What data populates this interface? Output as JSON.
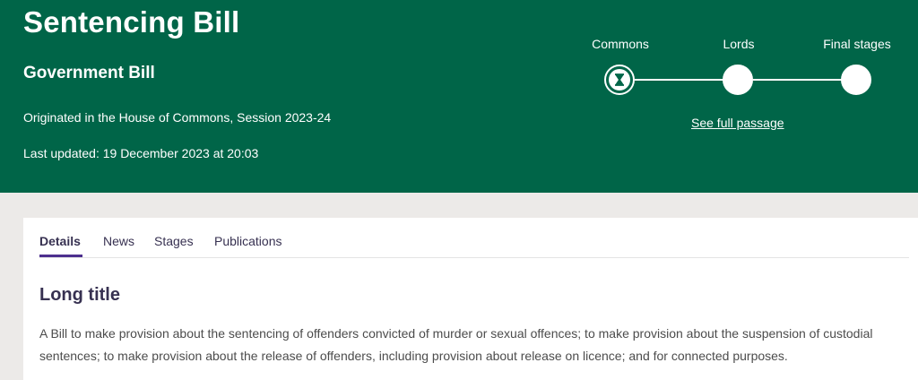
{
  "header": {
    "title": "Sentencing Bill",
    "bill_type": "Government Bill",
    "originated": "Originated in the House of Commons, Session 2023-24",
    "last_updated": "Last updated: 19 December 2023 at 20:03"
  },
  "progress": {
    "stages": [
      {
        "label": "Commons",
        "state": "current",
        "icon": "hourglass-icon"
      },
      {
        "label": "Lords",
        "state": "future"
      },
      {
        "label": "Final stages",
        "state": "future"
      }
    ],
    "see_full_passage": "See full passage"
  },
  "tabs": [
    {
      "label": "Details",
      "active": true
    },
    {
      "label": "News",
      "active": false
    },
    {
      "label": "Stages",
      "active": false
    },
    {
      "label": "Publications",
      "active": false
    }
  ],
  "details": {
    "heading": "Long title",
    "text": "A Bill to make provision about the sentencing of offenders convicted of murder or sexual offences; to make provision about the suspension of custodial sentences; to make provision about the release of offenders, including provision about release on licence; and for connected purposes."
  },
  "colors": {
    "header_bg": "#006548",
    "page_bg": "#eceae8",
    "tab_accent": "#4d2f8e",
    "heading_text": "#373151"
  }
}
